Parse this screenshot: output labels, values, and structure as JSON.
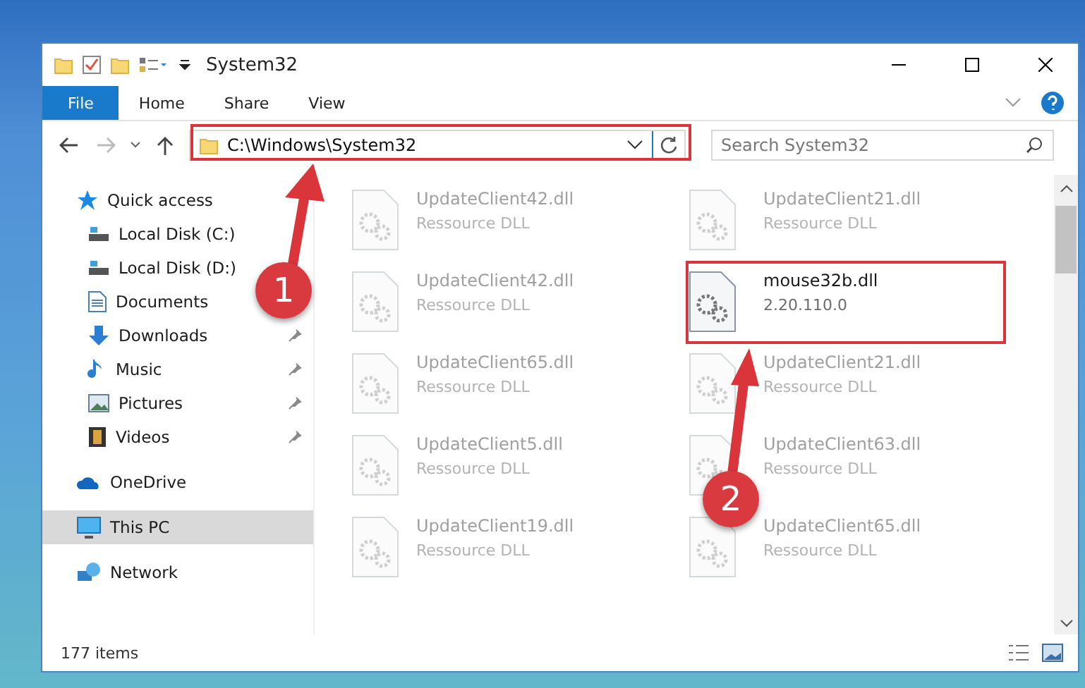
{
  "window": {
    "title": "System32"
  },
  "ribbon": {
    "tabs": [
      {
        "label": "File",
        "selected": true
      },
      {
        "label": "Home",
        "selected": false
      },
      {
        "label": "Share",
        "selected": false
      },
      {
        "label": "View",
        "selected": false
      }
    ]
  },
  "address": {
    "path": "C:\\Windows\\System32",
    "search_placeholder": "Search System32"
  },
  "sidebar": {
    "items": [
      {
        "label": "Quick access",
        "kind": "star",
        "selected": false,
        "children": [
          {
            "label": "Local Disk (C:)",
            "kind": "disk",
            "pinned": false,
            "selected": false
          },
          {
            "label": "Local Disk (D:)",
            "kind": "disk",
            "pinned": false,
            "selected": false
          },
          {
            "label": "Documents",
            "kind": "document",
            "pinned": false,
            "selected": false
          },
          {
            "label": "Downloads",
            "kind": "download",
            "pinned": true,
            "selected": false
          },
          {
            "label": "Music",
            "kind": "music",
            "pinned": true,
            "selected": false
          },
          {
            "label": "Pictures",
            "kind": "picture",
            "pinned": true,
            "selected": false
          },
          {
            "label": "Videos",
            "kind": "video",
            "pinned": true,
            "selected": false
          }
        ]
      },
      {
        "label": "OneDrive",
        "kind": "cloud",
        "selected": false
      },
      {
        "label": "This PC",
        "kind": "computer",
        "selected": true
      },
      {
        "label": "Network",
        "kind": "network",
        "selected": false
      }
    ]
  },
  "files": [
    {
      "name": "UpdateClient42.dll",
      "detail": "Ressource DLL",
      "highlighted": false
    },
    {
      "name": "UpdateClient21.dll",
      "detail": "Ressource DLL",
      "highlighted": false
    },
    {
      "name": "UpdateClient42.dll",
      "detail": "Ressource DLL",
      "highlighted": false
    },
    {
      "name": "mouse32b.dll",
      "detail": "2.20.110.0",
      "highlighted": true
    },
    {
      "name": "UpdateClient65.dll",
      "detail": "Ressource DLL",
      "highlighted": false
    },
    {
      "name": "UpdateClient21.dll",
      "detail": "Ressource DLL",
      "highlighted": false
    },
    {
      "name": "UpdateClient5.dll",
      "detail": "Ressource DLL",
      "highlighted": false
    },
    {
      "name": "UpdateClient63.dll",
      "detail": "Ressource DLL",
      "highlighted": false
    },
    {
      "name": "UpdateClient19.dll",
      "detail": "Ressource DLL",
      "highlighted": false
    },
    {
      "name": "UpdateClient65.dll",
      "detail": "Ressource DLL",
      "highlighted": false
    }
  ],
  "status_bar": {
    "count": "177 items"
  },
  "annotations": [
    {
      "number": "1"
    },
    {
      "number": "2"
    }
  ]
}
